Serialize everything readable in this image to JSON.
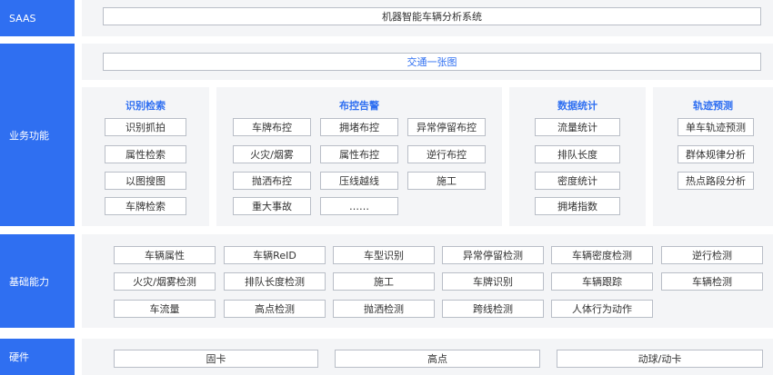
{
  "rows": {
    "saas": {
      "label": "SAAS",
      "system_title": "机器智能车辆分析系统"
    },
    "business": {
      "label": "业务功能",
      "banner": "交通一张图",
      "panels": {
        "recognition": {
          "title": "识别检索",
          "items": [
            "识别抓拍",
            "属性检索",
            "以图搜图",
            "车牌检索"
          ]
        },
        "alarm": {
          "title": "布控告警",
          "items": [
            "车牌布控",
            "拥堵布控",
            "异常停留布控",
            "火灾/烟雾",
            "属性布控",
            "逆行布控",
            "抛洒布控",
            "压线越线",
            "施工",
            "重大事故",
            "……"
          ]
        },
        "stats": {
          "title": "数据统计",
          "items": [
            "流量统计",
            "排队长度",
            "密度统计",
            "拥堵指数"
          ]
        },
        "trajectory": {
          "title": "轨迹预测",
          "items": [
            "单车轨迹预测",
            "群体规律分析",
            "热点路段分析"
          ]
        }
      }
    },
    "capability": {
      "label": "基础能力",
      "items": [
        "车辆属性",
        "车辆ReID",
        "车型识别",
        "异常停留检测",
        "车辆密度检测",
        "逆行检测",
        "火灾/烟雾检测",
        "排队长度检测",
        "施工",
        "车牌识别",
        "车辆跟踪",
        "车辆检测",
        "车流量",
        "高点检测",
        "抛洒检测",
        "跨线检测",
        "人体行为动作"
      ]
    },
    "hardware": {
      "label": "硬件",
      "items": [
        "固卡",
        "高点",
        "动球/动卡"
      ]
    }
  }
}
